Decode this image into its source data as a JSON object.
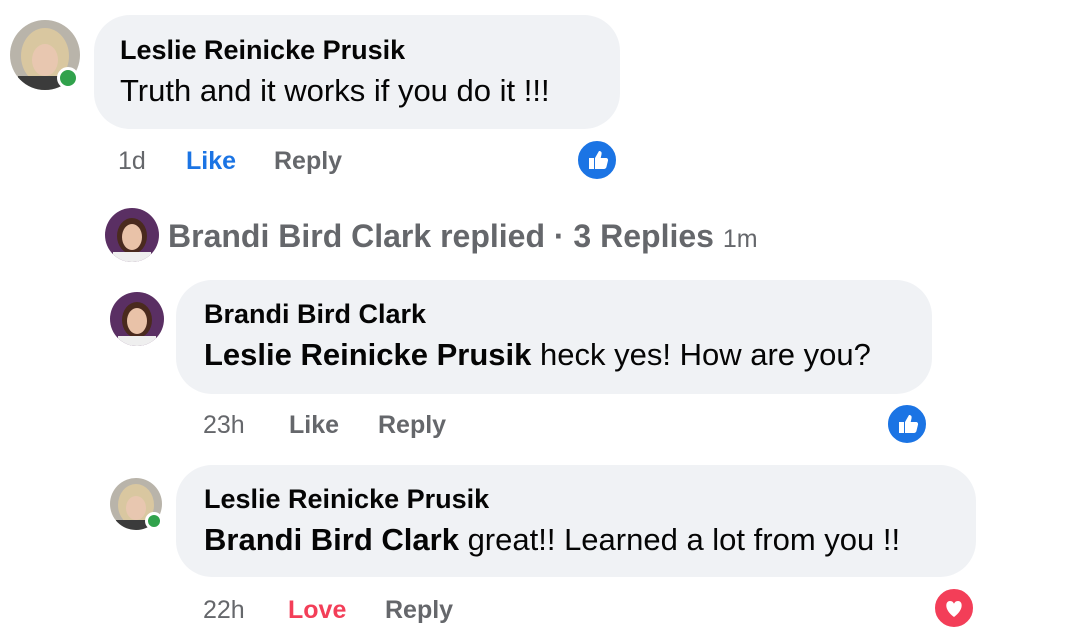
{
  "comments": [
    {
      "author": "Leslie Reinicke Prusik",
      "text": "Truth and it works if you do it !!!",
      "time": "1d",
      "like_label": "Like",
      "reply_label": "Reply",
      "reaction_icon": "like-reaction-icon"
    }
  ],
  "replied_summary": {
    "name": "Brandi Bird Clark",
    "verb": "replied",
    "separator": "·",
    "count_label": "3 Replies",
    "time": "1m"
  },
  "replies": [
    {
      "author": "Brandi Bird Clark",
      "mention": "Leslie Reinicke Prusik",
      "text": " heck yes! How are you?",
      "time": "23h",
      "like_label": "Like",
      "reply_label": "Reply",
      "reaction_icon": "like-reaction-icon"
    },
    {
      "author": "Leslie Reinicke Prusik",
      "mention": "Brandi Bird Clark",
      "text": " great!! Learned a lot from you !!",
      "time": "22h",
      "like_label": "Love",
      "reply_label": "Reply",
      "reaction_icon": "love-reaction-icon"
    }
  ],
  "colors": {
    "bubble_bg": "#f0f2f5",
    "like_blue": "#1b74e4",
    "love_red": "#f33e58",
    "meta_gray": "#65676b",
    "online_green": "#31a24c"
  }
}
